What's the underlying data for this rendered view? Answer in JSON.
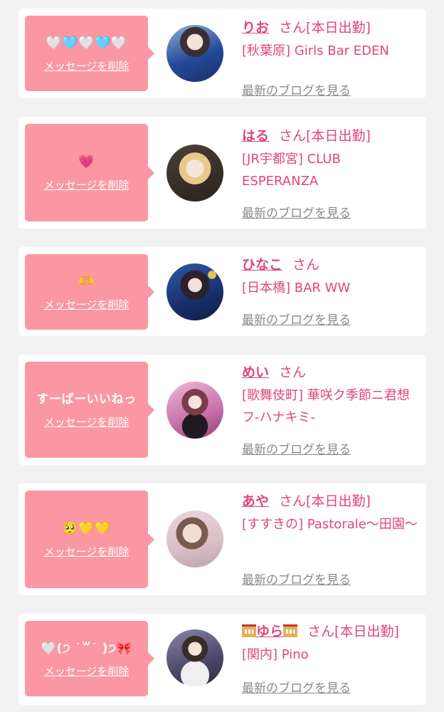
{
  "delete_label": "メッセージを削除",
  "blog_label": "最新のブログを見る",
  "san": "さん",
  "entries": [
    {
      "message": "🤍🩵🤍🩵🤍",
      "name": "りお",
      "status": "[本日出勤]",
      "shop": "[秋葉原] Girls Bar EDEN"
    },
    {
      "message": "💗",
      "name": "はる",
      "status": "[本日出勤]",
      "shop": "[JR宇都宮] CLUB ESPERANZA"
    },
    {
      "message": "🫶",
      "name": "ひなこ",
      "status": "",
      "shop": "[日本橋] BAR WW"
    },
    {
      "message": "すーぱーいいねっ",
      "name": "めい",
      "status": "",
      "shop": "[歌舞伎町] 華咲ク季節ニ君想フ-ハナキミ-"
    },
    {
      "message": "🥺💛💛",
      "name": "あや",
      "status": "[本日出勤]",
      "shop": "[すすきの] Pastorale〜田園〜"
    },
    {
      "message": "🤍(੭ ˙꒳˙ )੭🎀",
      "name": "ゆら",
      "status": "[本日出勤]",
      "shop": "[関内] Pino"
    }
  ],
  "colors": {
    "accent": "#e0457b",
    "bubble": "#fb97a3",
    "background": "#f2f2f2"
  }
}
